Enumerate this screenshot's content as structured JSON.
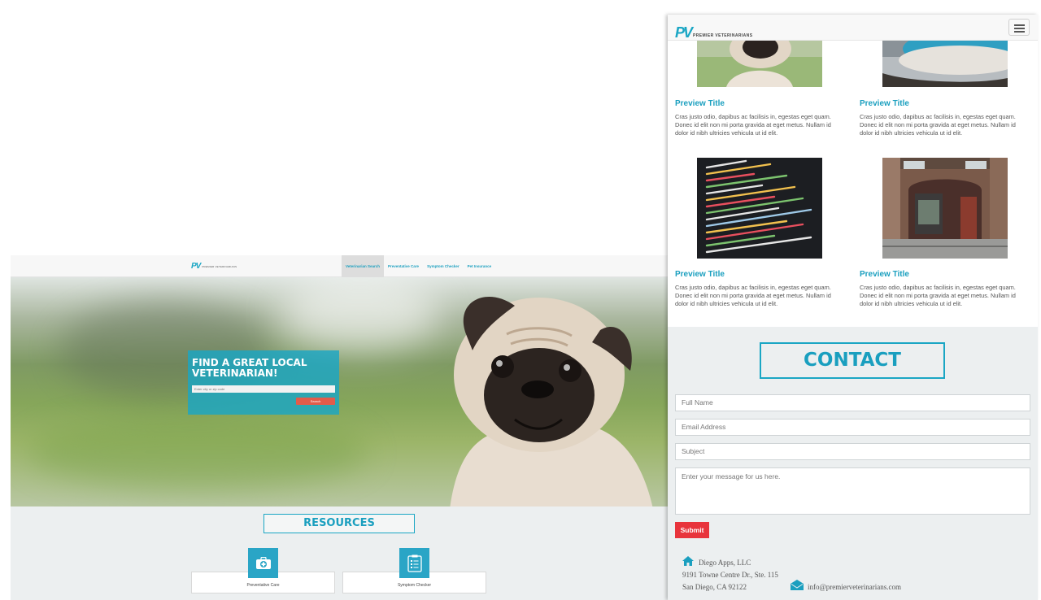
{
  "desktop": {
    "logo_mark": "PV",
    "logo_word": "PREMIER VETERINARIANS",
    "nav": [
      {
        "label": "Veterinarian Search",
        "active": true
      },
      {
        "label": "Preventative Care",
        "active": false
      },
      {
        "label": "Symptom Checker",
        "active": false
      },
      {
        "label": "Pet Insurance",
        "active": false
      }
    ],
    "hero": {
      "title": "FIND A GREAT LOCAL VETERINARIAN!",
      "input_placeholder": "Enter city or zip code",
      "button_label": "Search"
    },
    "resources_title": "RESOURCES",
    "resources": [
      {
        "label": "Preventative Care",
        "icon": "medical-kit-icon"
      },
      {
        "label": "Symptom Checker",
        "icon": "checklist-icon"
      }
    ]
  },
  "mobile": {
    "logo_mark": "PV",
    "logo_word": "PREMIER VETERINARIANS",
    "previews": [
      {
        "title": "Preview Title",
        "text": "Cras justo odio, dapibus ac facilisis in, egestas eget quam. Donec id elit non mi porta gravida at eget metus. Nullam id dolor id nibh ultricies vehicula ut id elit.",
        "image": "pug-photo"
      },
      {
        "title": "Preview Title",
        "text": "Cras justo odio, dapibus ac facilisis in, egestas eget quam. Donec id elit non mi porta gravida at eget metus. Nullam id dolor id nibh ultricies vehicula ut id elit.",
        "image": "bowl-photo"
      },
      {
        "title": "Preview Title",
        "text": "Cras justo odio, dapibus ac facilisis in, egestas eget quam. Donec id elit non mi porta gravida at eget metus. Nullam id dolor id nibh ultricies vehicula ut id elit.",
        "image": "code-screen-photo"
      },
      {
        "title": "Preview Title",
        "text": "Cras justo odio, dapibus ac facilisis in, egestas eget quam. Donec id elit non mi porta gravida at eget metus. Nullam id dolor id nibh ultricies vehicula ut id elit.",
        "image": "storefront-photo"
      }
    ],
    "contact": {
      "title": "CONTACT",
      "full_name_placeholder": "Full Name",
      "email_placeholder": "Email Address",
      "subject_placeholder": "Subject",
      "message_placeholder": "Enter your message for us here.",
      "submit_label": "Submit",
      "company": "Diego Apps, LLC",
      "street": "9191 Towne Centre Dr., Ste. 115",
      "city": "San Diego, CA 92122",
      "email": "info@premierveterinarians.com"
    }
  },
  "colors": {
    "brand": "#1aa6c4",
    "accent_red": "#e8343c",
    "section_bg": "#eceff0"
  }
}
